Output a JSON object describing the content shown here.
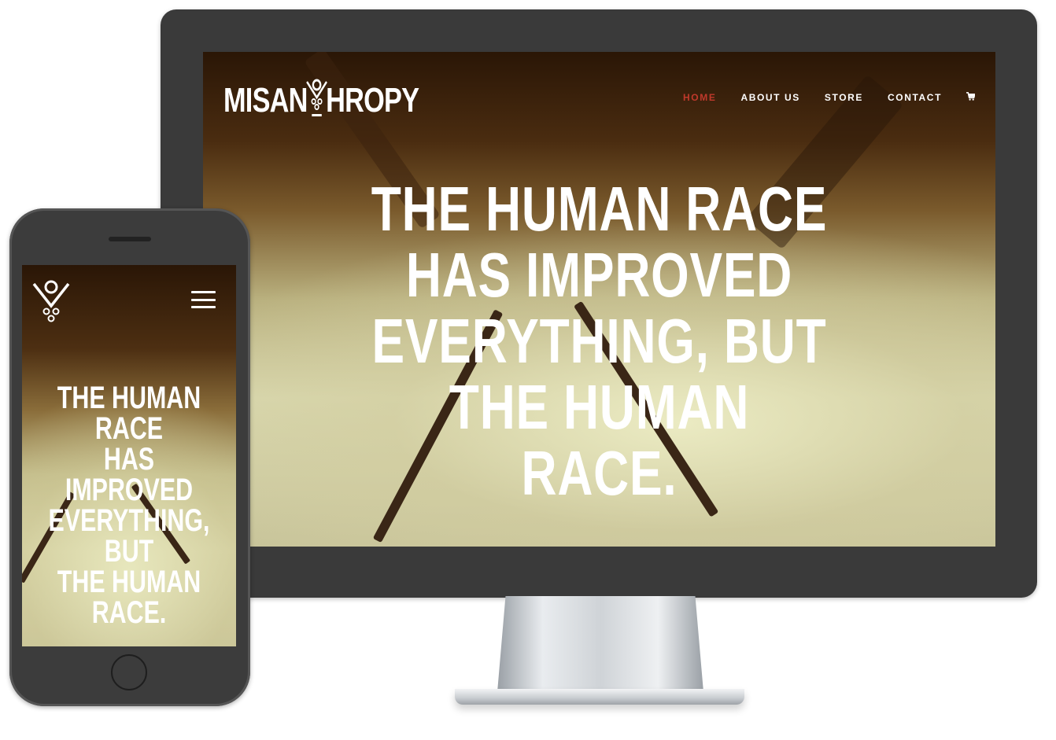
{
  "desktop": {
    "logo_left": "MISAN",
    "logo_right": "HROPY",
    "nav": [
      {
        "label": "HOME",
        "active": true
      },
      {
        "label": "ABOUT US",
        "active": false
      },
      {
        "label": "STORE",
        "active": false
      },
      {
        "label": "CONTACT",
        "active": false
      }
    ],
    "cart_icon": "shopping-cart-icon",
    "headline_lines": [
      "THE HUMAN RACE",
      "HAS IMPROVED",
      "EVERYTHING, BUT",
      "THE HUMAN",
      "RACE."
    ]
  },
  "phone": {
    "logo_icon": "logo-icon",
    "menu_icon": "hamburger-menu-icon",
    "headline_lines": [
      "THE HUMAN RACE",
      "HAS IMPROVED",
      "EVERYTHING, BUT",
      "THE HUMAN",
      "RACE."
    ]
  },
  "colors": {
    "accent": "#c0392b",
    "bezel": "#3a3a3a",
    "text": "#ffffff"
  }
}
